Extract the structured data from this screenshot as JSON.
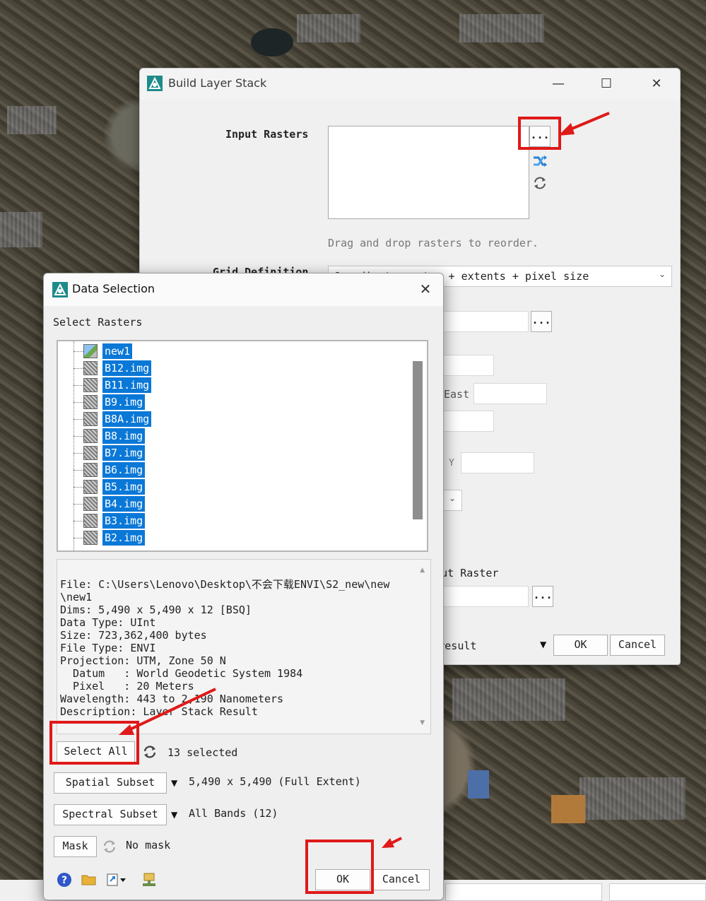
{
  "build_layer_stack": {
    "title": "Build Layer Stack",
    "window_controls": {
      "minimize": "—",
      "maximize": "☐",
      "close": "✕"
    },
    "input_rasters_label": "Input Rasters",
    "browse_label": "...",
    "hint": "Drag and drop rasters to reorder.",
    "grid_definition_label": "Grid Definition",
    "grid_definition_value": "Coordinate system + extents + pixel size",
    "east_label": "East",
    "y_label": "Y",
    "output_raster_label": "Output Raster",
    "display_result_label": "Display result",
    "ok_label": "OK",
    "cancel_label": "Cancel"
  },
  "data_selection": {
    "title": "Data Selection",
    "close": "✕",
    "select_rasters_label": "Select Rasters",
    "rasters": [
      "new1",
      "B12.img",
      "B11.img",
      "B9.img",
      "B8A.img",
      "B8.img",
      "B7.img",
      "B6.img",
      "B5.img",
      "B4.img",
      "B3.img",
      "B2.img"
    ],
    "info_lines": [
      "File: C:\\Users\\Lenovo\\Desktop\\不会下载ENVI\\S2_new\\new",
      "\\new1",
      "Dims: 5,490 x 5,490 x 12 [BSQ]",
      "Data Type: UInt",
      "Size: 723,362,400 bytes",
      "File Type: ENVI",
      "Projection: UTM, Zone 50 N",
      "  Datum   : World Geodetic System 1984",
      "  Pixel   : 20 Meters",
      "Wavelength: 443 to 2,190 Nanometers",
      "Description: Layer Stack Result"
    ],
    "select_all_label": "Select All",
    "selected_count": "13 selected",
    "spatial_subset_label": "Spatial Subset",
    "spatial_subset_value": "5,490 x 5,490 (Full Extent)",
    "spectral_subset_label": "Spectral Subset",
    "spectral_subset_value": "All Bands (12)",
    "mask_label": "Mask",
    "mask_value": "No mask",
    "ok_label": "OK",
    "cancel_label": "Cancel",
    "bottom_icons": [
      "help-icon",
      "open-folder-icon",
      "open-menu-icon",
      "network-icon"
    ]
  },
  "annotation_color": "#e01919",
  "selection_color": "#0a78d7"
}
